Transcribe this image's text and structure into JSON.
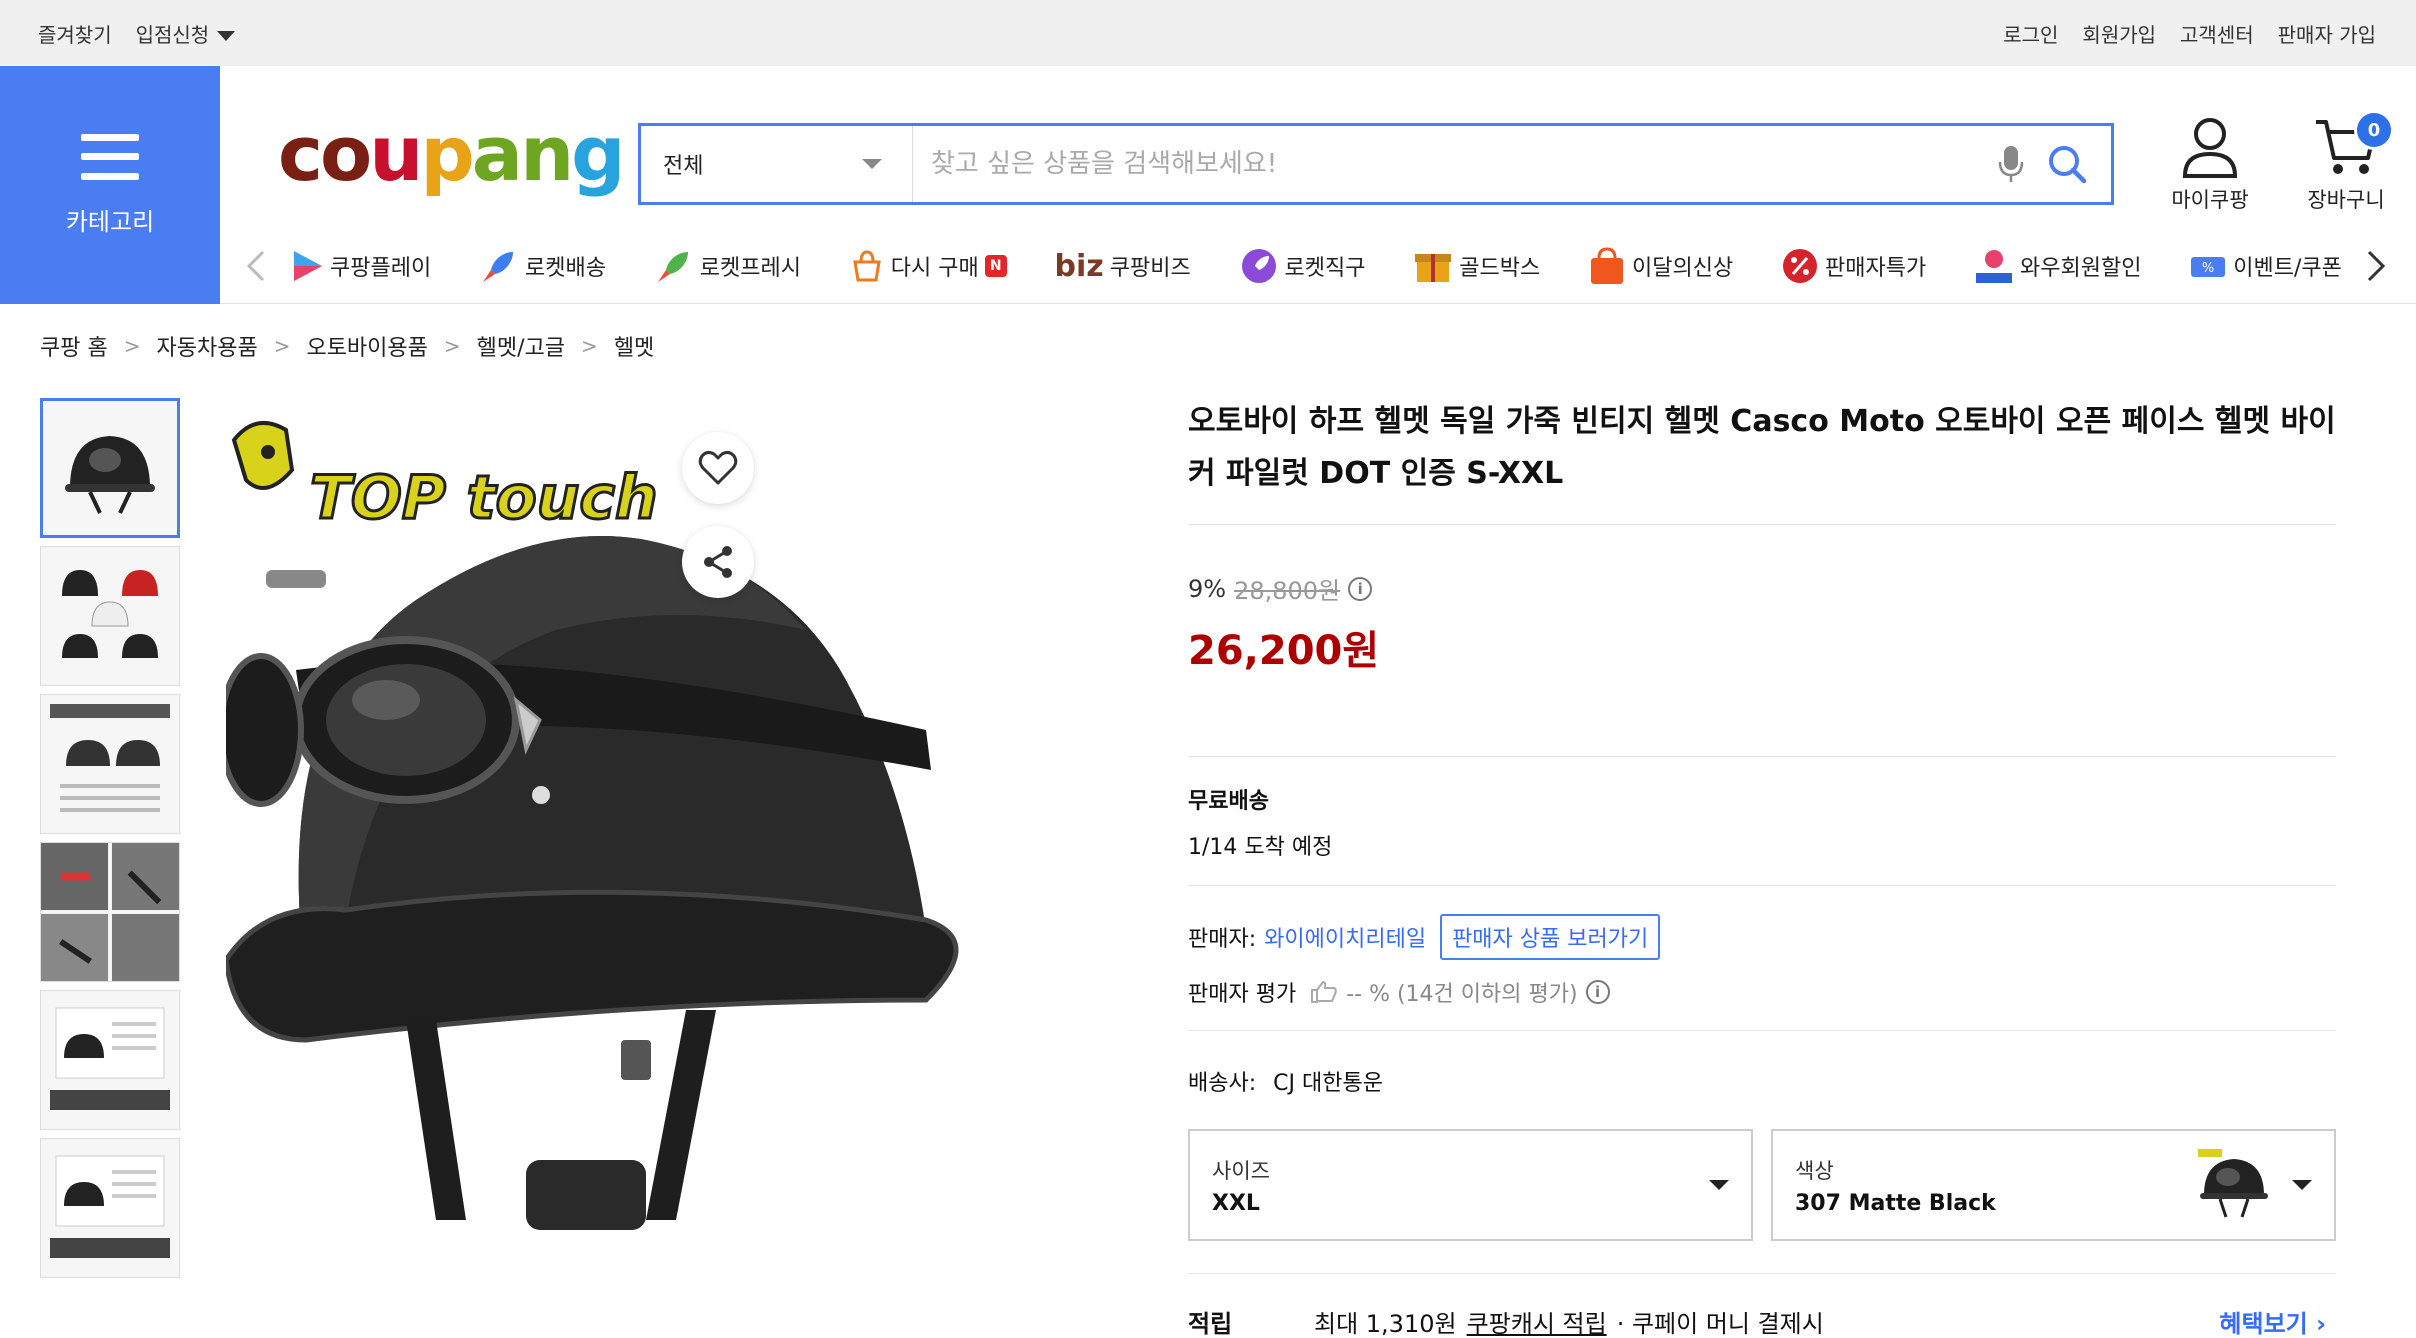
{
  "topbar": {
    "favorites": "즐겨찾기",
    "seller_apply": "입점신청",
    "login": "로그인",
    "signup": "회원가입",
    "customer_center": "고객센터",
    "seller_signup": "판매자 가입"
  },
  "header": {
    "category_label": "카테고리",
    "logo_text": "coupang",
    "search_category": "전체",
    "search_placeholder": "찾고 싶은 상품을 검색해보세요!",
    "my_coupang": "마이쿠팡",
    "cart": "장바구니",
    "cart_count": "0"
  },
  "nav": {
    "items": [
      {
        "label": "쿠팡플레이",
        "icon": "play-icon"
      },
      {
        "label": "로켓배송",
        "icon": "rocket-icon"
      },
      {
        "label": "로켓프레시",
        "icon": "rocket-fresh-icon"
      },
      {
        "label": "다시 구매",
        "icon": "rebuy-icon",
        "badge": "N"
      },
      {
        "label": "쿠팡비즈",
        "icon": "biz-icon",
        "prefix": "biz"
      },
      {
        "label": "로켓직구",
        "icon": "rocket-global-icon"
      },
      {
        "label": "골드박스",
        "icon": "goldbox-icon"
      },
      {
        "label": "이달의신상",
        "icon": "new-bag-icon"
      },
      {
        "label": "판매자특가",
        "icon": "percent-icon"
      },
      {
        "label": "와우회원할인",
        "icon": "wow-icon"
      },
      {
        "label": "이벤트/쿠폰",
        "icon": "coupon-icon"
      }
    ]
  },
  "breadcrumb": [
    "쿠팡 홈",
    "자동차용품",
    "오토바이용품",
    "헬멧/고글",
    "헬멧"
  ],
  "product": {
    "title": "오토바이 하프 헬멧 독일 가죽 빈티지 헬멧 Casco Moto 오토바이 오픈 페이스 헬멧 바이커 파일럿 DOT 인증 S-XXL",
    "brand_overlay": "TOP touch",
    "discount_rate": "9%",
    "original_price": "28,800원",
    "sale_price": "26,200원",
    "shipping_type": "무료배송",
    "arrival": "1/14 도착 예정",
    "seller_label": "판매자:",
    "seller_name": "와이에이치리테일",
    "seller_products_btn": "판매자 상품 보러가기",
    "seller_rating_label": "판매자 평가",
    "seller_rating_value": "-- % (14건 이하의 평가)",
    "carrier_label": "배송사:",
    "carrier_name": "CJ 대한통운",
    "size_label": "사이즈",
    "size_value": "XXL",
    "color_label": "색상",
    "color_value": "307 Matte Black",
    "reward_label": "적립",
    "reward_text": "최대 1,310원",
    "reward_link": "쿠팡캐시 적립",
    "reward_suffix": "· 쿠페이 머니 결제시",
    "benefit_link": "혜택보기"
  },
  "colors": {
    "accent": "#4a7cf2",
    "price_red": "#ae0000",
    "link_blue": "#346aff"
  }
}
